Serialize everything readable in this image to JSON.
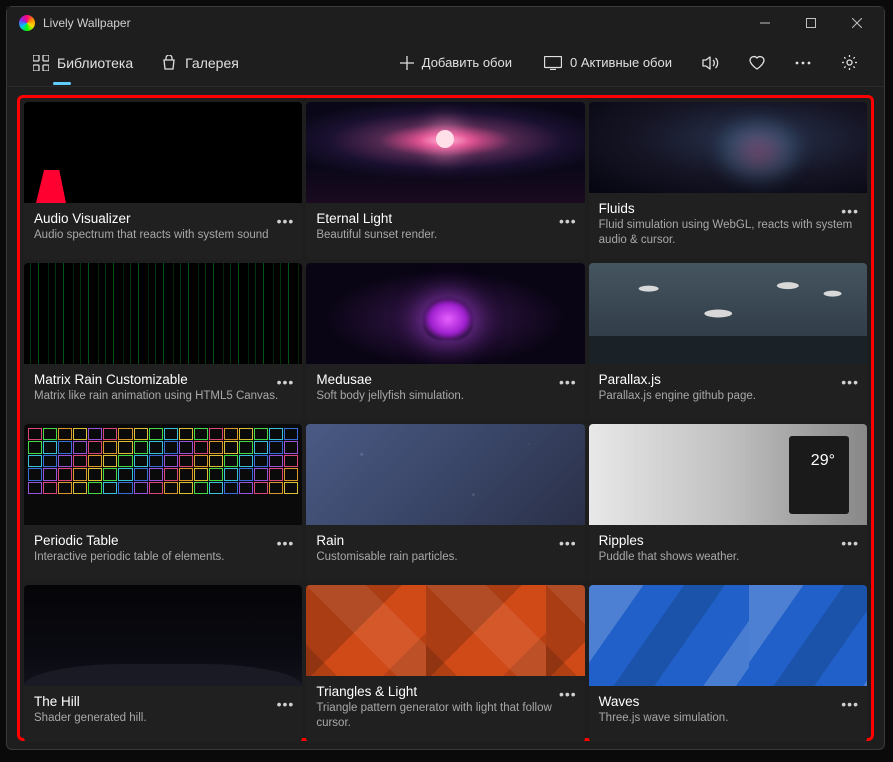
{
  "window": {
    "title": "Lively Wallpaper"
  },
  "nav": {
    "library": "Библиотека",
    "gallery": "Галерея"
  },
  "toolbar": {
    "add": "Добавить обои",
    "active": "0 Активные обои"
  },
  "cards": [
    {
      "title": "Audio Visualizer",
      "desc": "Audio spectrum that reacts with system sound"
    },
    {
      "title": "Eternal Light",
      "desc": "Beautiful sunset render."
    },
    {
      "title": "Fluids",
      "desc": "Fluid simulation using WebGL, reacts with system audio & cursor."
    },
    {
      "title": "Matrix Rain Customizable",
      "desc": "Matrix like rain animation using HTML5 Canvas."
    },
    {
      "title": "Medusae",
      "desc": "Soft body jellyfish simulation."
    },
    {
      "title": "Parallax.js",
      "desc": "Parallax.js engine github page."
    },
    {
      "title": "Periodic Table",
      "desc": "Interactive periodic table of elements."
    },
    {
      "title": "Rain",
      "desc": "Customisable rain particles."
    },
    {
      "title": "Ripples",
      "desc": "Puddle that shows weather."
    },
    {
      "title": "The Hill",
      "desc": "Shader generated hill."
    },
    {
      "title": "Triangles & Light",
      "desc": "Triangle pattern generator with light that follow cursor."
    },
    {
      "title": "Waves",
      "desc": "Three.js wave simulation."
    }
  ]
}
